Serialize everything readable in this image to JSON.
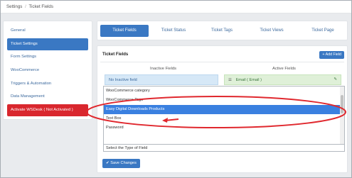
{
  "breadcrumb": {
    "root": "Settings",
    "separator": "/",
    "current": "Ticket Fields"
  },
  "sidebar": {
    "items": [
      {
        "label": "General"
      },
      {
        "label": "Ticket Settings"
      },
      {
        "label": "Form Settings"
      },
      {
        "label": "WooCommerce"
      },
      {
        "label": "Triggers & Automation"
      },
      {
        "label": "Data Management"
      },
      {
        "label": "Activate WSDesk ( Not Activated )"
      }
    ]
  },
  "tabs": [
    {
      "label": "Ticket Fields"
    },
    {
      "label": "Ticket Status"
    },
    {
      "label": "Ticket Tags"
    },
    {
      "label": "Ticket Views"
    },
    {
      "label": "Ticket Page"
    }
  ],
  "panel": {
    "title": "Ticket Fields",
    "add_field_label": "+ Add Field",
    "inactive_header": "Inactive Fields",
    "active_header": "Active Fields",
    "inactive_placeholder": "No Inactive field",
    "active_field": "Email ( Email )"
  },
  "dropdown": {
    "options": [
      "WooCommerce category",
      "WooCommerce Tags",
      "Easy Digital Downloads Products",
      "Text Box",
      "Password"
    ],
    "selected_index": 2,
    "field_value": "Select the Type of Field"
  },
  "save_button": "Save Changes",
  "colors": {
    "accent": "#3a78c3",
    "danger": "#d9272e",
    "highlight_annotation": "#e0282e"
  }
}
